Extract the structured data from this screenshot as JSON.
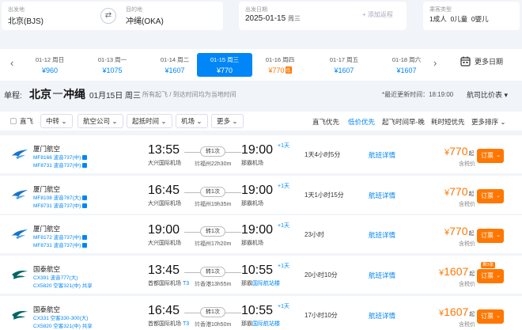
{
  "search": {
    "from_label": "出发地",
    "from_value": "北京(BJS)",
    "to_label": "目的地",
    "to_value": "冲绳(OKA)",
    "date_label": "出发日期",
    "date_value": "2025-01-15",
    "date_weekday": "周三",
    "add_trip": "+ 添加返程",
    "pax_label": "乘客类型",
    "pax_value": "1成人  0儿童  0婴儿"
  },
  "dates": [
    {
      "date": "01-12 周日",
      "price": "¥960",
      "selected": false,
      "low": false
    },
    {
      "date": "01-13 周一",
      "price": "¥1075",
      "selected": false,
      "low": false
    },
    {
      "date": "01-14 周二",
      "price": "¥1607",
      "selected": false,
      "low": false
    },
    {
      "date": "01-15 周三",
      "price": "¥770",
      "selected": true,
      "low": false
    },
    {
      "date": "01-16 周四",
      "price": "¥770",
      "selected": false,
      "low": true
    },
    {
      "date": "01-17 周五",
      "price": "¥1607",
      "selected": false,
      "low": false
    },
    {
      "date": "01-18 周六",
      "price": "¥1607",
      "selected": false,
      "low": false
    }
  ],
  "low_tag": "低",
  "calendar_label": "更多日期",
  "route": {
    "type": "单程:",
    "from": "北京",
    "to": "冲绳",
    "date": "01月15日 周三",
    "note": "所有起飞 / 到达时间均为当地时间",
    "updated": "*最近更新时间：18:19:00",
    "compare": "航司比价表 ▾"
  },
  "filters": {
    "direct": "直飞",
    "transfer": "中转",
    "airline": "航空公司",
    "time": "起抵时间",
    "airport": "机场",
    "more": "更多",
    "sort_direct": "直飞优先",
    "sort_low": "低价优先",
    "sort_early": "起飞时间早-晚",
    "sort_short": "耗时短优先",
    "sort_more": "更多排序"
  },
  "flights": [
    {
      "airline": "厦门航空",
      "code1": "MF8166 波音737(中)",
      "code2": "MF8731 波音737(中)",
      "dep": "13:55",
      "dep_airport": "大兴国际机场",
      "dep_term": "",
      "stop": "转1次",
      "stop_k": "转",
      "stop_info": "福州22h30m",
      "arr": "19:00",
      "arr_airport": "那霸机场",
      "plus": "+1天",
      "duration": "1天4小时5分",
      "detail": "航班详情",
      "price": "770",
      "tax": "含税价",
      "book": "订票",
      "quota": ""
    },
    {
      "airline": "厦门航空",
      "code1": "MF8108 波音787(大)",
      "code2": "MF8731 波音737(中)",
      "dep": "16:45",
      "dep_airport": "大兴国际机场",
      "dep_term": "",
      "stop": "转1次",
      "stop_k": "转",
      "stop_info": "福州19h35m",
      "arr": "19:00",
      "arr_airport": "那霸机场",
      "plus": "+1天",
      "duration": "1天1小时15分",
      "detail": "航班详情",
      "price": "770",
      "tax": "含税价",
      "book": "订票",
      "quota": ""
    },
    {
      "airline": "厦门航空",
      "code1": "MF8172 波音737(中)",
      "code2": "MF8731 波音737(中)",
      "dep": "19:00",
      "dep_airport": "大兴国际机场",
      "dep_term": "",
      "stop": "转1次",
      "stop_k": "转",
      "stop_info": "福州17h20m",
      "arr": "19:00",
      "arr_airport": "那霸机场",
      "plus": "+1天",
      "duration": "23小时",
      "detail": "航班详情",
      "price": "770",
      "tax": "含税价",
      "book": "订票",
      "quota": ""
    },
    {
      "airline": "国泰航空",
      "code1": "CX391 波音777(大)",
      "code2": "CX5820 空客321(中)  共享",
      "dep": "13:45",
      "dep_airport": "首都国际机场",
      "dep_term": "T3",
      "stop": "转1次",
      "stop_k": "转",
      "stop_info": "香港13h55m",
      "arr": "10:55",
      "arr_airport": "那霸",
      "arr_term": "国际航站楼",
      "plus": "+1天",
      "duration": "20小时10分",
      "detail": "航班详情",
      "price": "1607",
      "tax": "含税价",
      "book": "订票",
      "quota": "剩3张"
    },
    {
      "airline": "国泰航空",
      "code1": "CX331 空客330-300(大)",
      "code2": "CX5820 空客321(中)  共享",
      "dep": "16:45",
      "dep_airport": "首都国际机场",
      "dep_term": "T3",
      "stop": "转1次",
      "stop_k": "转",
      "stop_info": "香港10h50m",
      "arr": "10:55",
      "arr_airport": "那霸",
      "arr_term": "国际航站楼",
      "plus": "+1天",
      "duration": "17小时10分",
      "detail": "航班详情",
      "price": "1607",
      "tax": "含税价",
      "book": "订票",
      "quota": ""
    }
  ],
  "colors": {
    "primary": "#0086f6",
    "accent": "#ff7700",
    "xiamen": "#1a73c8",
    "cathay": "#006564"
  }
}
